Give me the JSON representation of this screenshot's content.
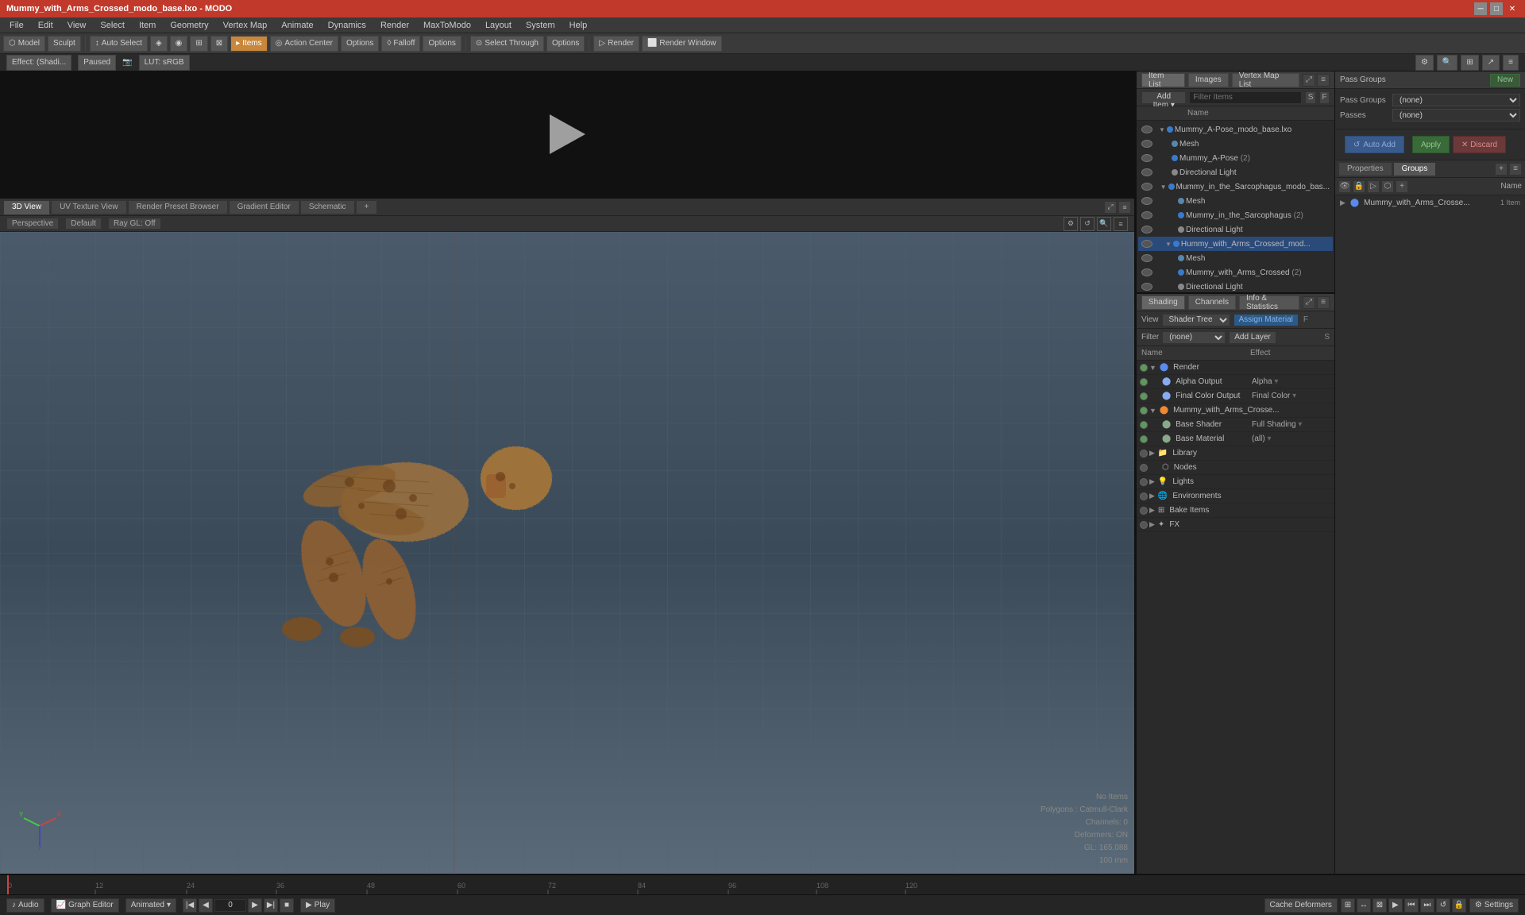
{
  "window": {
    "title": "Mummy_with_Arms_Crossed_modo_base.lxo - MODO",
    "controls": [
      "minimize",
      "maximize",
      "close"
    ]
  },
  "menu": {
    "items": [
      "File",
      "Edit",
      "View",
      "Select",
      "Item",
      "Geometry",
      "Vertex Map",
      "Animate",
      "Dynamics",
      "Render",
      "MaxToModo",
      "Layout",
      "System",
      "Help"
    ]
  },
  "toolbar": {
    "mode_buttons": [
      "Model",
      "Sculpt"
    ],
    "auto_select": "Auto Select",
    "items_btn": "Items",
    "action_center": "Action Center",
    "options1": "Options",
    "falloff": "Falloff",
    "options2": "Options",
    "select_through": "Select Through",
    "options3": "Options",
    "render": "Render",
    "render_window": "Render Window"
  },
  "view_options": {
    "effect": "Effect: (Shadi...",
    "paused": "Paused",
    "lut": "LUT: sRGB"
  },
  "viewport_tabs": [
    "3D View",
    "UV Texture View",
    "Render Preset Browser",
    "Gradient Editor",
    "Schematic"
  ],
  "viewport": {
    "view_mode": "Perspective",
    "shading": "Default",
    "ray_gl": "Ray GL: Off",
    "stats": {
      "items": "No Items",
      "polygons": "Polygons : Catmull-Clark",
      "channels": "Channels: 0",
      "deformers": "Deformers: ON",
      "gl": "GL: 165,088",
      "scale": "100 mm"
    }
  },
  "item_list": {
    "panel_tabs": [
      "Item List",
      "Images",
      "Vertex Map List"
    ],
    "add_item_label": "Add Item",
    "filter_label": "Filter Items",
    "col_header": "Name",
    "items": [
      {
        "id": 1,
        "name": "Mummy_A-Pose_modo_base.lxo",
        "level": 0,
        "expanded": true,
        "type": "scene"
      },
      {
        "id": 2,
        "name": "Mesh",
        "level": 2,
        "type": "mesh"
      },
      {
        "id": 3,
        "name": "Mummy_A-Pose",
        "level": 2,
        "type": "group",
        "count": "(2)"
      },
      {
        "id": 4,
        "name": "Directional Light",
        "level": 2,
        "type": "light"
      },
      {
        "id": 5,
        "name": "Mummy_in_the_Sarcophagus_modo_bas...",
        "level": 1,
        "expanded": true,
        "type": "scene"
      },
      {
        "id": 6,
        "name": "Mesh",
        "level": 3,
        "type": "mesh"
      },
      {
        "id": 7,
        "name": "Mummy_in_the_Sarcophagus",
        "level": 3,
        "type": "group",
        "count": "(2)"
      },
      {
        "id": 8,
        "name": "Directional Light",
        "level": 3,
        "type": "light"
      },
      {
        "id": 9,
        "name": "Hummy_with_Arms_Crossed_mod...",
        "level": 1,
        "expanded": true,
        "type": "scene",
        "selected": true
      },
      {
        "id": 10,
        "name": "Mesh",
        "level": 3,
        "type": "mesh"
      },
      {
        "id": 11,
        "name": "Mummy_with_Arms_Crossed",
        "level": 3,
        "type": "group",
        "count": "(2)"
      },
      {
        "id": 12,
        "name": "Directional Light",
        "level": 3,
        "type": "light"
      }
    ]
  },
  "shading": {
    "panel_tabs": [
      "Shading",
      "Channels",
      "Info & Statistics"
    ],
    "view_label": "View",
    "view_val": "Shader Tree",
    "assign_material": "Assign Material",
    "filter_label": "Filter",
    "filter_val": "(none)",
    "add_layer": "Add Layer",
    "col_name": "Name",
    "col_effect": "Effect",
    "items": [
      {
        "id": 1,
        "name": "Render",
        "level": 0,
        "expanded": true,
        "type": "render",
        "vis": true
      },
      {
        "id": 2,
        "name": "Alpha Output",
        "level": 1,
        "type": "output",
        "effect": "Alpha",
        "vis": true
      },
      {
        "id": 3,
        "name": "Final Color Output",
        "level": 1,
        "type": "output",
        "effect": "Final Color",
        "vis": true
      },
      {
        "id": 4,
        "name": "Mummy_with_Arms_Crosse...",
        "level": 1,
        "expanded": true,
        "type": "group",
        "vis": true
      },
      {
        "id": 5,
        "name": "Base Shader",
        "level": 2,
        "type": "shader",
        "effect": "Full Shading",
        "vis": true
      },
      {
        "id": 6,
        "name": "Base Material",
        "level": 2,
        "type": "material",
        "effect": "(all)",
        "vis": true
      },
      {
        "id": 7,
        "name": "Library",
        "level": 1,
        "type": "folder",
        "vis": false
      },
      {
        "id": 8,
        "name": "Nodes",
        "level": 2,
        "type": "nodes",
        "vis": false
      },
      {
        "id": 9,
        "name": "Lights",
        "level": 0,
        "type": "lights",
        "vis": false
      },
      {
        "id": 10,
        "name": "Environments",
        "level": 0,
        "type": "env",
        "vis": false
      },
      {
        "id": 11,
        "name": "Bake Items",
        "level": 0,
        "type": "bake",
        "vis": false
      },
      {
        "id": 12,
        "name": "FX",
        "level": 0,
        "type": "fx",
        "vis": false
      }
    ]
  },
  "pass_groups": {
    "label": "Pass Groups",
    "pass_groups_val": "(none)",
    "passes_label": "Passes",
    "passes_val": "(none)",
    "new_btn": "New",
    "auto_add_btn": "Auto Add",
    "apply_btn": "Apply",
    "discard_btn": "Discard"
  },
  "properties_panel": {
    "tabs": [
      "Properties",
      "Groups"
    ],
    "groups_header_name": "Name",
    "group_name": "Mummy_with_Arms_Crosse...",
    "group_count": "1 Item"
  },
  "timeline": {
    "marks": [
      0,
      12,
      24,
      36,
      48,
      60,
      72,
      84,
      96,
      108,
      120
    ],
    "current_frame": "0",
    "end_frame": "120"
  },
  "status_bar": {
    "audio_btn": "Audio",
    "graph_editor": "Graph Editor",
    "animated_label": "Animated",
    "play_btn": "Play",
    "cache_deformers": "Cache Deformers",
    "settings": "Settings"
  }
}
